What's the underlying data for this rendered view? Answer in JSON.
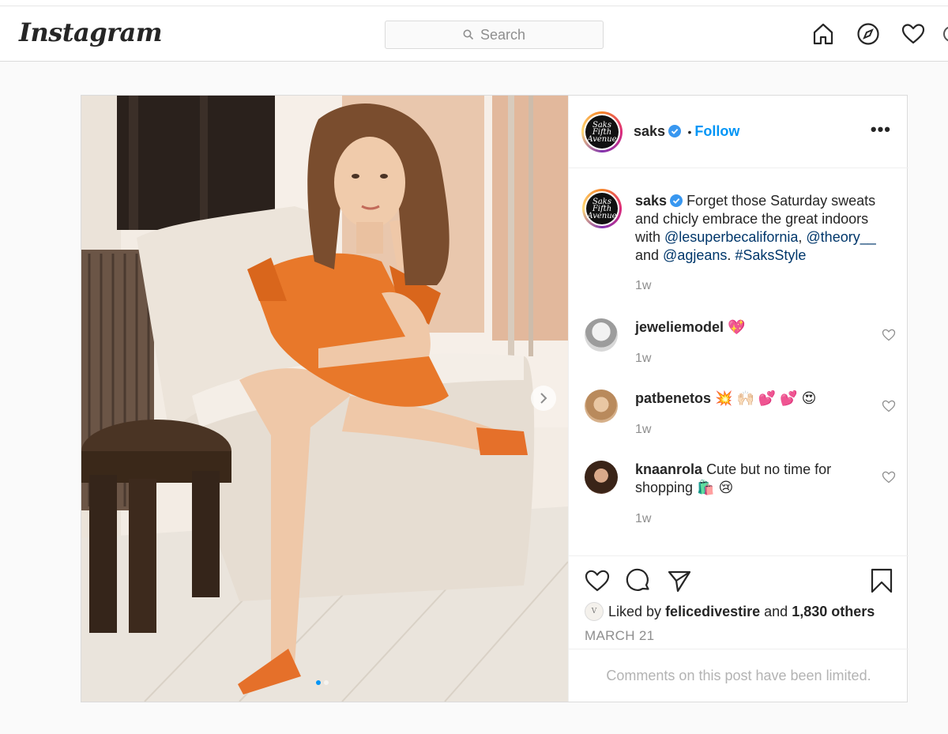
{
  "brand": {
    "logo_text": "Instagram"
  },
  "search": {
    "placeholder": "Search"
  },
  "nav": {
    "icons": [
      "home-icon",
      "explore-icon",
      "activity-heart-icon"
    ]
  },
  "post": {
    "author": {
      "username": "saks",
      "avatar_text": "Saks Fifth Avenue",
      "verified": true
    },
    "follow_separator": "•",
    "follow_label": "Follow",
    "more_label": "•••",
    "caption": {
      "username": "saks",
      "text_1": "Forget those Saturday sweats and chicly embrace the great indoors with ",
      "mention_1": "@lesuperbecalifornia",
      "sep_1": ", ",
      "mention_2": "@theory__",
      "text_2": " and ",
      "mention_3": "@agjeans",
      "sep_2": ". ",
      "hashtag": "#SaksStyle",
      "time": "1w"
    },
    "comments": [
      {
        "username": "jeweliemodel",
        "text": "💖",
        "time": "1w"
      },
      {
        "username": "patbenetos",
        "text": "💥 🙌🏻 💕 💕 😍",
        "time": "1w"
      },
      {
        "username": "knaanrola",
        "text": "Cute but no time for shopping 🛍️ 😢",
        "time": "1w"
      }
    ],
    "likes": {
      "prefix": "Liked by",
      "user": "felicedivestire",
      "conjunction": "and",
      "others": "1,830 others",
      "avatar_text": "V"
    },
    "date": "MARCH 21",
    "comments_limited": "Comments on this post have been limited.",
    "carousel": {
      "slide_count": 2,
      "active_index": 0
    }
  },
  "colors": {
    "accent": "#0095f6",
    "link": "#00376b",
    "muted": "#8e8e8e",
    "dress": "#e8782a"
  }
}
